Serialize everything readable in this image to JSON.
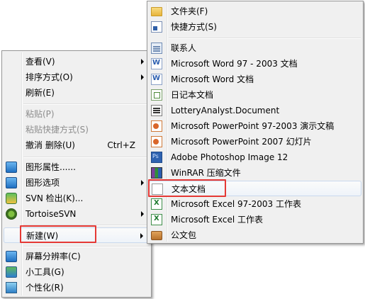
{
  "context_menu": {
    "items": [
      {
        "label": "查看(V)",
        "submenu": true,
        "icon": "none"
      },
      {
        "label": "排序方式(O)",
        "submenu": true,
        "icon": "none"
      },
      {
        "label": "刷新(E)",
        "icon": "none"
      },
      {
        "label": "粘贴(P)",
        "disabled": true,
        "icon": "none"
      },
      {
        "label": "粘贴快捷方式(S)",
        "disabled": true,
        "icon": "none"
      },
      {
        "label": "撤消 删除(U)",
        "shortcut": "Ctrl+Z",
        "icon": "none"
      },
      {
        "label": "图形属性......",
        "icon": "graphics-properties-icon"
      },
      {
        "label": "图形选项",
        "submenu": true,
        "icon": "graphics-options-icon"
      },
      {
        "label": "SVN 检出(K)...",
        "icon": "svn-checkout-icon"
      },
      {
        "label": "TortoiseSVN",
        "submenu": true,
        "icon": "tortoisesvn-icon"
      },
      {
        "label": "新建(W)",
        "submenu": true,
        "highlighted": true,
        "icon": "none"
      },
      {
        "label": "屏幕分辨率(C)",
        "icon": "screen-resolution-icon"
      },
      {
        "label": "小工具(G)",
        "icon": "gadgets-icon"
      },
      {
        "label": "个性化(R)",
        "icon": "personalize-icon"
      }
    ]
  },
  "new_submenu": {
    "items": [
      {
        "label": "文件夹(F)",
        "icon": "folder-icon"
      },
      {
        "label": "快捷方式(S)",
        "icon": "shortcut-icon"
      },
      {
        "label": "联系人",
        "icon": "contact-icon"
      },
      {
        "label": "Microsoft Word 97 - 2003 文档",
        "icon": "word-icon"
      },
      {
        "label": "Microsoft Word 文档",
        "icon": "word-icon"
      },
      {
        "label": "日记本文档",
        "icon": "journal-icon"
      },
      {
        "label": "LotteryAnalyst.Document",
        "icon": "document-icon"
      },
      {
        "label": "Microsoft PowerPoint 97-2003 演示文稿",
        "icon": "powerpoint-icon"
      },
      {
        "label": "Microsoft PowerPoint 2007 幻灯片",
        "icon": "powerpoint-icon"
      },
      {
        "label": "Adobe Photoshop Image 12",
        "icon": "photoshop-icon"
      },
      {
        "label": "WinRAR 压缩文件",
        "icon": "winrar-icon"
      },
      {
        "label": "文本文档",
        "icon": "text-document-icon",
        "highlighted": true
      },
      {
        "label": "Microsoft Excel 97-2003 工作表",
        "icon": "excel-icon"
      },
      {
        "label": "Microsoft Excel 工作表",
        "icon": "excel-icon"
      },
      {
        "label": "公文包",
        "icon": "briefcase-icon"
      }
    ]
  },
  "colors": {
    "menu_bg": "#f0f0f0",
    "highlight_box": "#e53935",
    "disabled_text": "#8d8d8d"
  }
}
